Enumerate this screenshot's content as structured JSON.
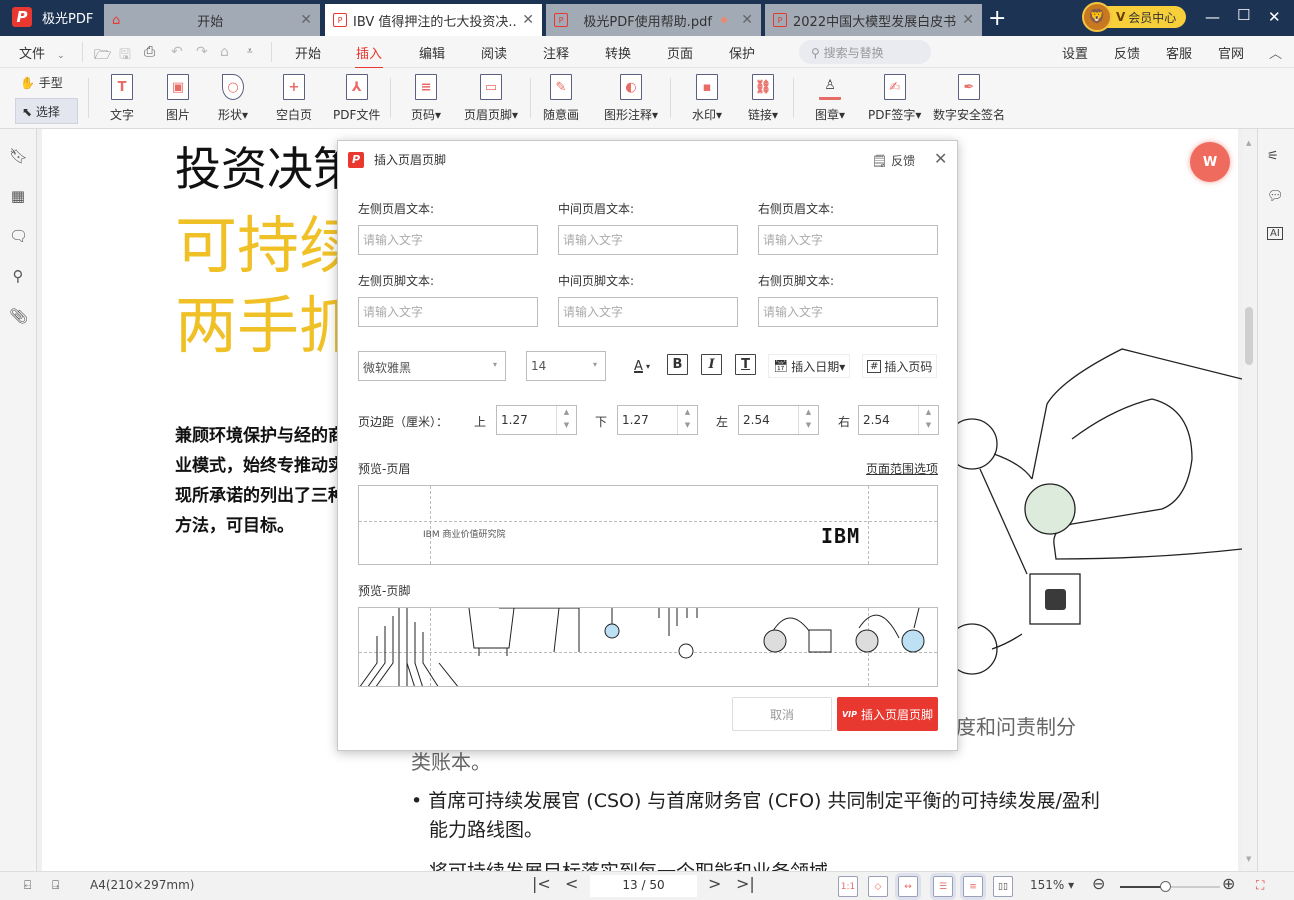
{
  "app": {
    "name": "极光PDF",
    "accent": "#e8382f",
    "titlebar_color": "#1c3353"
  },
  "tabs": [
    {
      "label": "开始",
      "icon": "home-icon",
      "active": false
    },
    {
      "label": "IBV 值得押注的七大投资决...",
      "icon": "pdf-icon",
      "active": true
    },
    {
      "label": "极光PDF使用帮助.pdf",
      "icon": "pdf-icon",
      "active": false,
      "unsaved": true
    },
    {
      "label": "2022中国大模型发展白皮书...",
      "icon": "pdf-icon",
      "active": false
    }
  ],
  "vip": {
    "label": "会员中心",
    "badge": "V"
  },
  "menu": {
    "file": "文件",
    "items": [
      "开始",
      "插入",
      "编辑",
      "阅读",
      "注释",
      "转换",
      "页面",
      "保护"
    ],
    "active": "插入",
    "search_placeholder": "搜索与替换",
    "right": [
      "设置",
      "反馈",
      "客服",
      "官网"
    ]
  },
  "ribbon": {
    "hand": "手型",
    "select": "选择",
    "buttons": [
      {
        "label": "文字",
        "icon": "text-icon"
      },
      {
        "label": "图片",
        "icon": "image-icon"
      },
      {
        "label": "形状▾",
        "icon": "shape-icon"
      },
      {
        "label": "空白页",
        "icon": "blank-page-icon"
      },
      {
        "label": "PDF文件",
        "icon": "pdf-file-icon"
      },
      {
        "label": "页码▾",
        "icon": "page-number-icon"
      },
      {
        "label": "页眉页脚▾",
        "icon": "header-footer-icon"
      },
      {
        "label": "随意画",
        "icon": "freehand-icon"
      },
      {
        "label": "图形注释▾",
        "icon": "shape-annotation-icon"
      },
      {
        "label": "水印▾",
        "icon": "watermark-icon"
      },
      {
        "label": "链接▾",
        "icon": "link-icon"
      },
      {
        "label": "图章▾",
        "icon": "stamp-icon"
      },
      {
        "label": "PDF签字▾",
        "icon": "signature-icon"
      },
      {
        "label": "数字安全签名",
        "icon": "digital-signature-icon"
      }
    ]
  },
  "document": {
    "heading_black": "投资决策",
    "heading_yellow_1": "可持续",
    "heading_yellow_2": "两手抓",
    "paragraph": "兼顾环境保护与经的商业模式，始终专推动实现所承诺的列出了三种方法，可目标。",
    "line_a": "度和问责制分",
    "line_b": "类账本。",
    "bullet_1": "首席可持续发展官 (CSO) 与首席财务官 (CFO) 共同制定平衡的可持续发展/盈利",
    "bullet_1b": "能力路线图。",
    "line_c": "将可持续发展目标落实到每一个职能和业务领域"
  },
  "dialog": {
    "title": "插入页眉页脚",
    "feedback": "反馈",
    "fields": {
      "header_left_label": "左侧页眉文本:",
      "header_center_label": "中间页眉文本:",
      "header_right_label": "右侧页眉文本:",
      "footer_left_label": "左侧页脚文本:",
      "footer_center_label": "中间页脚文本:",
      "footer_right_label": "右侧页脚文本:",
      "placeholder": "请输入文字"
    },
    "font": "微软雅黑",
    "font_size": "14",
    "insert_date": "插入日期▾",
    "insert_page_number": "插入页码",
    "margin_label": "页边距（厘米）：",
    "margins": {
      "top_label": "上",
      "top": "1.27",
      "bottom_label": "下",
      "bottom": "1.27",
      "left_label": "左",
      "left": "2.54",
      "right_label": "右",
      "right": "2.54"
    },
    "preview_header_label": "预览-页眉",
    "page_range_link": "页面范围选项",
    "preview_header_text": "IBM 商业价值研究院",
    "preview_header_logo": "IBM",
    "preview_footer_label": "预览-页脚",
    "cancel": "取消",
    "confirm": "插入页眉页脚",
    "confirm_badge": "VIP"
  },
  "status": {
    "page_size": "A4(210×297mm)",
    "page_display": "13 / 50",
    "current_page": 13,
    "total_pages": 50,
    "zoom": "151%",
    "zoom_slider_fraction": 0.45
  }
}
